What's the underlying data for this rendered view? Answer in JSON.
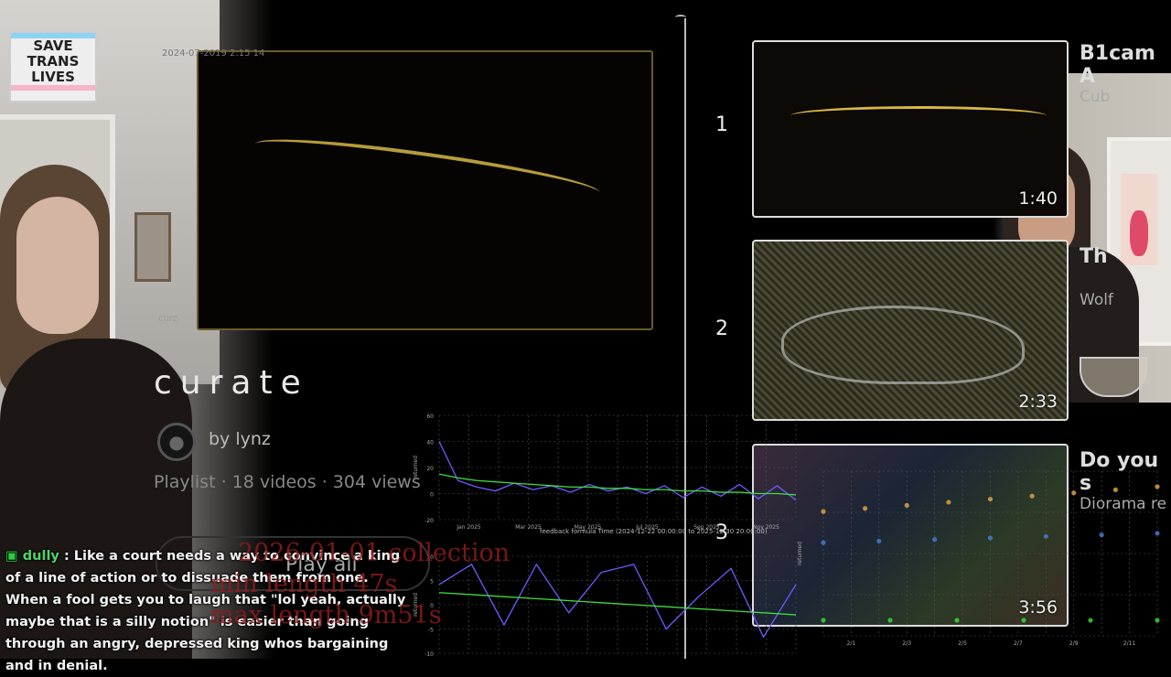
{
  "webcam_left": {
    "poster_text": [
      "SAVE",
      "TRANS",
      "LIVES"
    ]
  },
  "main_video": {
    "header_text": "2024-07-2019 2:15 14",
    "footer_text": "curz"
  },
  "playlist": {
    "title": "curate",
    "author": "by lynz",
    "meta": "Playlist · 18 videos · 304 views",
    "play_all_label": "Play all"
  },
  "video_list": [
    {
      "index": "1",
      "title": "B1cam A",
      "subtitle": "Cub",
      "duration": "1:40"
    },
    {
      "index": "2",
      "title": "Th",
      "subtitle": "Wolf",
      "duration": "2:33"
    },
    {
      "index": "3",
      "title": "Do you s",
      "subtitle": "Diorama re",
      "duration": "3:56"
    }
  ],
  "chat": {
    "user": "dully",
    "message": "Like a court needs a way to convince a king of a line of action or to dissuade them from one. When a fool gets you to laugh that \"lol yeah, actually maybe that is a silly notion\" is easier than going through an angry, depressed king whos bargaining and in denial."
  },
  "overlay_text": [
    "2026-01-01 collection",
    "min length 47s",
    "max length 9m51s"
  ],
  "chart_data": [
    {
      "type": "line",
      "title": "feedback formula Time (2024-12-22 00:00:00 to 2025-12-30 20:00:00)",
      "ylabel": "returned",
      "x_tick_labels": [
        "Jan 2025",
        "Mar 2025",
        "May 2025",
        "Jul 2025",
        "Sep 2025",
        "Nov 2025"
      ],
      "y_tick_labels": [
        "60",
        "40",
        "20",
        "0",
        "-20"
      ],
      "ylim": [
        -20,
        60
      ],
      "series": [
        {
          "color": "#6a5cff",
          "values": [
            40,
            10,
            5,
            2,
            8,
            3,
            6,
            1,
            7,
            2,
            5,
            0,
            6,
            -3,
            5,
            -2,
            7,
            -4,
            6,
            -5
          ]
        },
        {
          "color": "#3ddc3d",
          "values": [
            15,
            12,
            10,
            9,
            8,
            7,
            6,
            5,
            5,
            4,
            4,
            3,
            3,
            2,
            2,
            1,
            1,
            0,
            0,
            -1
          ]
        }
      ],
      "grid": true
    },
    {
      "type": "line",
      "ylabel": "returned",
      "y_tick_labels": [
        "10",
        "5",
        "0",
        "-5",
        "-10"
      ],
      "ylim": [
        -12,
        12
      ],
      "series": [
        {
          "color": "#6a5cff",
          "values": [
            5,
            10,
            -5,
            10,
            -2,
            8,
            10,
            -6,
            2,
            9,
            -8,
            5
          ]
        },
        {
          "color": "#3ddc3d",
          "values": [
            3,
            2.5,
            2,
            1.5,
            1,
            0.5,
            0,
            -0.5,
            -1,
            -1.5,
            -2,
            -2.5
          ]
        }
      ],
      "grid": true
    },
    {
      "type": "scatter",
      "ylabel": "returned",
      "x_tick_labels": [
        "2/1",
        "2/3",
        "2/5",
        "2/7",
        "2/9",
        "2/11"
      ],
      "series": [
        {
          "color": "#e5a84a",
          "values": [
            6,
            6.2,
            6.4,
            6.6,
            6.8,
            7,
            7.2,
            7.4,
            7.6
          ]
        },
        {
          "color": "#4a7ed8",
          "values": [
            4,
            4.1,
            4.2,
            4.3,
            4.4,
            4.5,
            4.6
          ]
        },
        {
          "color": "#3ddc3d",
          "values": [
            -1,
            -1,
            -1,
            -1,
            -1,
            -1
          ]
        }
      ],
      "grid": true
    }
  ]
}
